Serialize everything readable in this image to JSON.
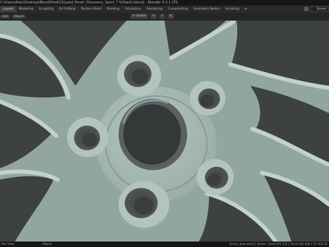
{
  "window": {
    "title": "C:\\Users\\Alan\\Desktop\\Blend\\Prod\\15\\Land_Rover_Discovery_Sport_7.5(fixed).blend] - Blender 4.2.1 LTS"
  },
  "workspace_tabs": [
    {
      "label": "Layout",
      "active": true
    },
    {
      "label": "Modeling",
      "active": false
    },
    {
      "label": "Sculpting",
      "active": false
    },
    {
      "label": "UV Editing",
      "active": false
    },
    {
      "label": "Texture Paint",
      "active": false
    },
    {
      "label": "Shading",
      "active": false
    },
    {
      "label": "Animation",
      "active": false
    },
    {
      "label": "Rendering",
      "active": false
    },
    {
      "label": "Compositing",
      "active": false
    },
    {
      "label": "Geometry Nodes",
      "active": false
    },
    {
      "label": "Scripting",
      "active": false
    }
  ],
  "workspace_add_label": "+",
  "scene": {
    "label": "Scene"
  },
  "header": {
    "items": [
      "Add",
      "Object"
    ],
    "orientation_label": "Global"
  },
  "status": {
    "left": "Pan View",
    "middle": "Object",
    "right": "Scene_alan.extra | Scene | Verts 0/1.27k | Faces 0/1.04k | Tris 0/2.5k"
  },
  "colors": {
    "viewport_bg": "#92a6a1",
    "hub_face": "#a7b9b4",
    "hole_dark": "#404343",
    "active_tab": "#3d3d3d"
  }
}
